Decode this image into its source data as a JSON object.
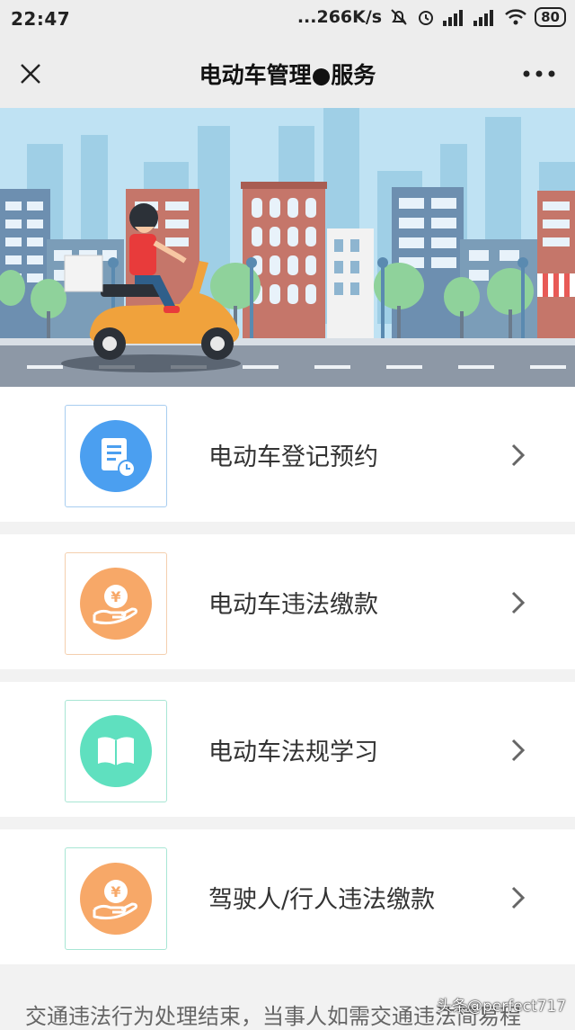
{
  "status_bar": {
    "time": "22:47",
    "net_speed": "...266K/s",
    "battery": "80"
  },
  "nav": {
    "title": "电动车管理●服务",
    "close_icon": "close-icon",
    "more_icon": "more-icon"
  },
  "banner": {
    "illustration": "scooter-rider-city-illustration"
  },
  "services": [
    {
      "label": "电动车登记预约",
      "icon": "document-clock-icon",
      "color": "#4b9ff0",
      "border": "#a8cdf0"
    },
    {
      "label": "电动车违法缴款",
      "icon": "yuan-hand-icon",
      "color": "#f7a868",
      "border": "#f4cfae"
    },
    {
      "label": "电动车法规学习",
      "icon": "book-icon",
      "color": "#5fe0bf",
      "border": "#a8e6d4"
    },
    {
      "label": "驾驶人/行人违法缴款",
      "icon": "yuan-hand-icon",
      "color": "#f7a868",
      "border": "#a8e6d4"
    }
  ],
  "footer_text": "交通违法行为处理结束，当事人如需交通违法简易程",
  "watermark": "头条@perfect717"
}
